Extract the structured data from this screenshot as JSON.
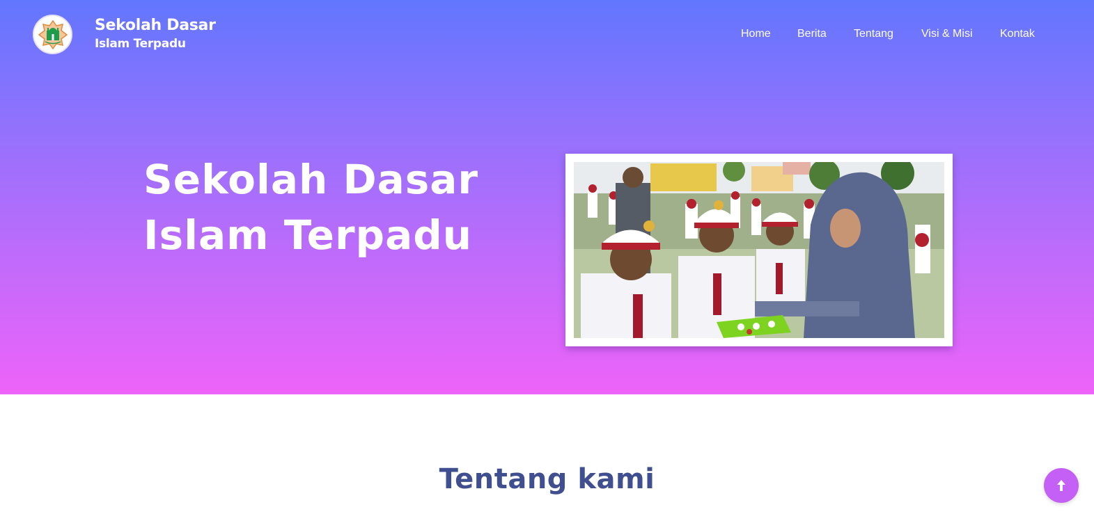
{
  "brand": {
    "line1": "Sekolah Dasar",
    "line2": "Islam Terpadu",
    "logo_icon": "school-emblem-icon"
  },
  "nav": {
    "items": [
      {
        "label": "Home"
      },
      {
        "label": "Berita"
      },
      {
        "label": "Tentang"
      },
      {
        "label": "Visi & Misi"
      },
      {
        "label": "Kontak"
      }
    ]
  },
  "hero": {
    "title_line1": "Sekolah Dasar",
    "title_line2": "Islam Terpadu",
    "gradient_colors": [
      "#6276fe",
      "#ee63f9"
    ]
  },
  "about": {
    "title": "Tentang kami"
  },
  "back_to_top": {
    "icon": "arrow-up-icon",
    "color": "#c560f7"
  }
}
